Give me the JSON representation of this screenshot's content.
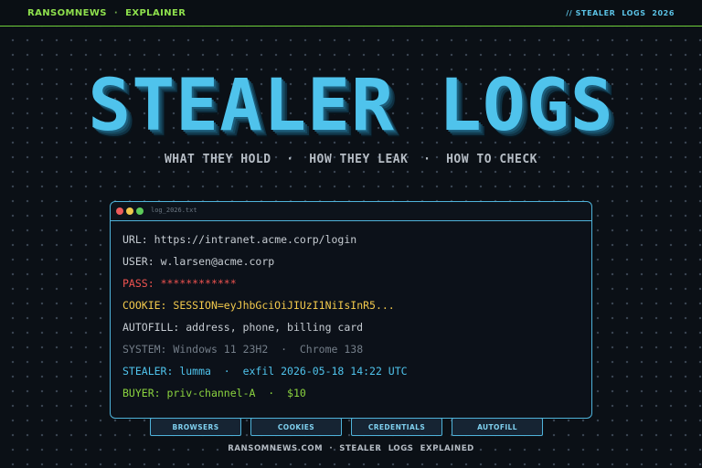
{
  "nav": {
    "brand": "RANSOMNEWS",
    "separator": "·",
    "section": "EXPLAINER",
    "tag": "// STEALER  LOGS  2026"
  },
  "hero": {
    "title": "STEALER LOGS",
    "subtitle": "WHAT THEY HOLD  ·  HOW THEY LEAK  ·  HOW TO CHECK"
  },
  "terminal": {
    "filename": "log_2026.txt",
    "lines": [
      {
        "key": "URL:",
        "value": "https://intranet.acme.corp/login"
      },
      {
        "key": "USER:",
        "value": "w.larsen@acme.corp"
      },
      {
        "key": "PASS:",
        "value": "************"
      },
      {
        "key": "COOKIE:",
        "value": "SESSION=eyJhbGciOiJIUzI1NiIsInR5..."
      },
      {
        "key": "AUTOFILL:",
        "value": "address, phone, billing card"
      },
      {
        "key": "SYSTEM:",
        "value": "Windows 11 23H2  ·  Chrome 138"
      },
      {
        "key": "STEALER:",
        "value": "lumma  ·  exfil 2026-05-18 14:22 UTC"
      },
      {
        "key": "BUYER:",
        "value": "priv-channel-A  ·  $10"
      }
    ]
  },
  "tabs": [
    "BROWSERS",
    "COOKIES",
    "CREDENTIALS",
    "AUTOFILL"
  ],
  "footer": {
    "text": "RANSOMNEWS.COM  ·  STEALER  LOGS  EXPLAINED"
  },
  "colors": {
    "accent_cyan": "#4fc3ec",
    "accent_green": "#8bd33f",
    "alert_red": "#ef5350",
    "warn_yellow": "#f2c94c",
    "background": "#0b1016"
  }
}
